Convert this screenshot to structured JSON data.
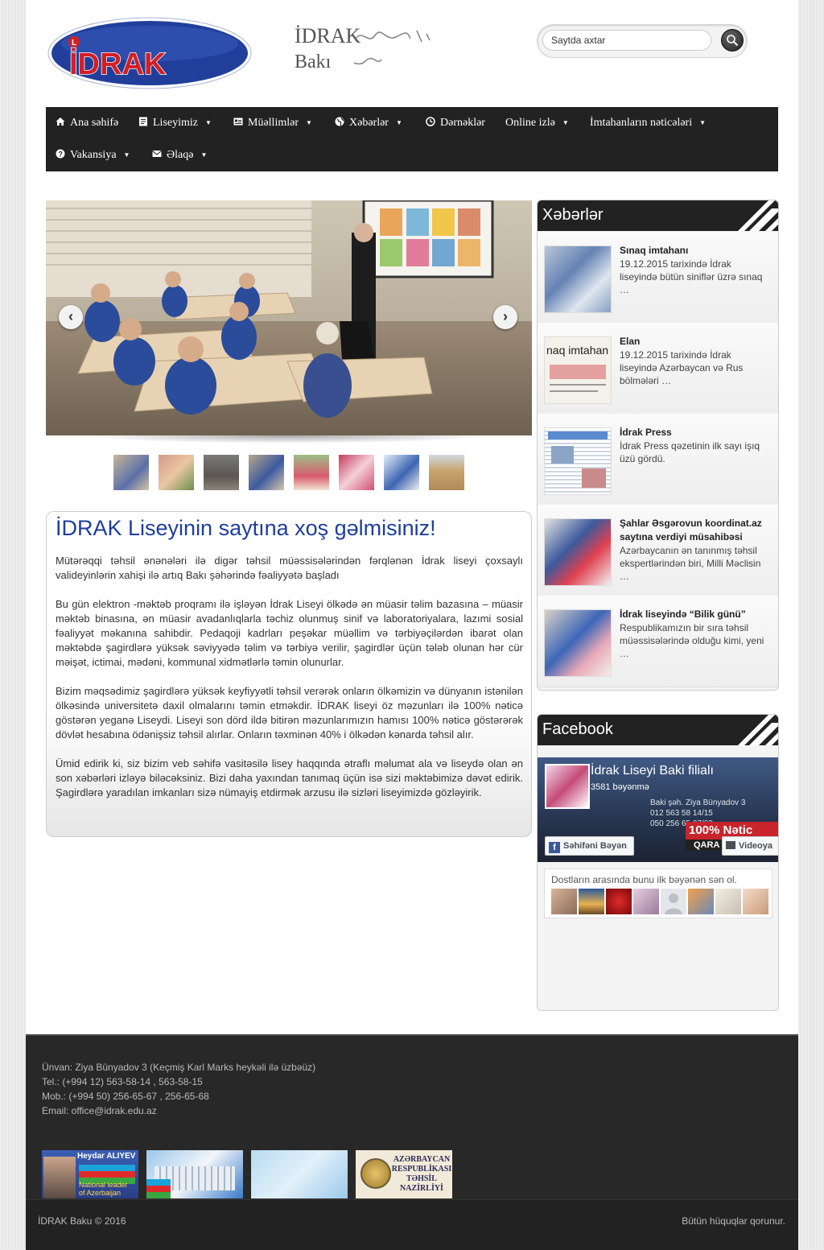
{
  "header": {
    "logo_text": "İDRAK",
    "site_name_line1": "İDRAK",
    "site_name_line2": "Bakı",
    "search_placeholder": "Saytda axtar"
  },
  "nav": {
    "items": [
      {
        "label": "Ana səhifə",
        "icon": "home-icon",
        "dropdown": false
      },
      {
        "label": "Liseyimiz",
        "icon": "document-icon",
        "dropdown": true
      },
      {
        "label": "Müəllimlər",
        "icon": "id-card-icon",
        "dropdown": true
      },
      {
        "label": "Xəbərlər",
        "icon": "globe-icon",
        "dropdown": true
      },
      {
        "label": "Dərnəklər",
        "icon": "clock-icon",
        "dropdown": false
      },
      {
        "label": "Online izlə",
        "icon": "",
        "dropdown": true
      },
      {
        "label": "İmtahanların nəticələri",
        "icon": "",
        "dropdown": true
      },
      {
        "label": "Vakansiya",
        "icon": "question-icon",
        "dropdown": true
      },
      {
        "label": "Əlaqə",
        "icon": "mail-icon",
        "dropdown": true
      }
    ]
  },
  "slider": {
    "prev_icon": "chevron-left-icon",
    "next_icon": "chevron-right-icon",
    "prev_label": "‹",
    "next_label": "›"
  },
  "welcome": {
    "title": "İDRAK Liseyinin saytına xoş gəlmisiniz!",
    "paragraphs": [
      "Mütərəqqi təhsil ənənələri ilə digər təhsil müəssisələrindən fərqlənən İdrak liseyi çoxsaylı valideyinlərin xahişi ilə artıq Bakı şəhərində fəaliyyətə başladı",
      "Bu gün elektron -məktəb proqramı ilə işləyən İdrak Liseyi ölkədə ən müasir təlim bazasına – müasir məktəb binasına, ən müasir avadanlıqlarla təchiz olunmuş sinif və laboratoriyalara, lazımi sosial fəaliyyət məkanına sahibdir. Pedaqoji kadrları peşəkar müəllim və tərbiyəçilərdən ibarət olan məktəbdə şagirdlərə yüksək səviyyədə təlim və tərbiyə verilir, şagirdlər üçün tələb olunan hər cür məişət, ictimai, mədəni, kommunal xidmətlərlə təmin olunurlar.",
      "Bizim məqsədimiz şagirdlərə yüksək keyfiyyətli təhsil verərək onların ölkəmizin və dünyanın istənilən ölkəsində universitetə daxil olmalarını təmin etməkdir. İDRAK liseyi öz məzunları ilə 100% nəticə göstərən yeganə Liseydi. Liseyi son dörd ildə bitirən məzunlarımızın hamısı 100% nəticə göstərərək dövlət hesabına ödənişsiz təhsil alırlar. Onların təxminən 40% i ölkədən kənarda təhsil alır.",
      "Ümid edirik ki, siz bizim veb səhifə vasitəsilə lisey haqqında ətraflı məlumat ala və liseydə olan ən son xəbərləri izləyə biləcəksiniz. Bizi daha yaxından tanımaq üçün isə sizi məktəbimizə dəvət edirik. Şagirdlərə yaradılan imkanları sizə nümayiş etdirmək arzusu ilə sizləri liseyimizdə gözləyirik."
    ]
  },
  "news": {
    "heading": "Xəbərlər",
    "items": [
      {
        "title": "Sınaq imtahanı",
        "text": "19.12.2015 tarixində İdrak liseyində bütün siniflər üzrə sınaq …"
      },
      {
        "title": "Elan",
        "text": "19.12.2015 tarixində İdrak liseyində Azərbaycan və Rus bölmələri …",
        "thumb_text": "naq imtahan"
      },
      {
        "title": "İdrak Press",
        "text": "İdrak Press qəzetinin ilk sayı işıq üzü gördü."
      },
      {
        "title": "Şahlar Əsgərovun koordinat.az saytına verdiyi müsahibəsi",
        "text": "Azərbaycanın ən tanınmış təhsil ekspertlərindən biri, Milli Məclisin …"
      },
      {
        "title": "İdrak liseyində “Bilik günü”",
        "text": "Respublikamızın bir sıra təhsil müəssisələrində olduğu kimi, yeni …"
      }
    ]
  },
  "facebook": {
    "heading": "Facebook",
    "page_name": "İdrak Liseyi Baki filialı",
    "likes": "3581 bəyənmə",
    "like_button": "Səhifəni Bəyən",
    "video_button": "Videoya",
    "cover_lines": [
      "Baki şəh. Ziya Bünyadov 3",
      "012 563 58 14/15",
      "050 256 65 67/68"
    ],
    "cover_banner": "100% Nətic",
    "cover_banner2": "QARA",
    "friends_text": "Dostların arasında bunu ilk bəyənən sən ol."
  },
  "footer": {
    "address": "Ünvan: Ziya Bünyadov 3 (Keçmiş Karl Marks heykəli ilə üzbəüz)",
    "tel": "Tel.: (+994 12) 563-58-14 , 563-58-15",
    "mob": "Mob.: (+994 50) 256-65-67 , 256-65-68",
    "email": "Email: office@idrak.edu.az",
    "banner1_title": "Heydar ALIYEV",
    "banner1_sub1": "National leader",
    "banner1_sub2": "of Azerbaijan",
    "banner4_lines": [
      "AZƏRBAYCAN",
      "RESPUBLİKASI",
      "TƏHSİL",
      "NAZİRLİYİ"
    ],
    "copyright": "İDRAK Baku  © 2016",
    "rights": "Bütün hüquqlar qorunur."
  },
  "colors": {
    "nav_bg": "#222222",
    "title_blue": "#1f3d9c",
    "logo_blue": "#1f3f9a",
    "logo_red": "#d21f26"
  }
}
